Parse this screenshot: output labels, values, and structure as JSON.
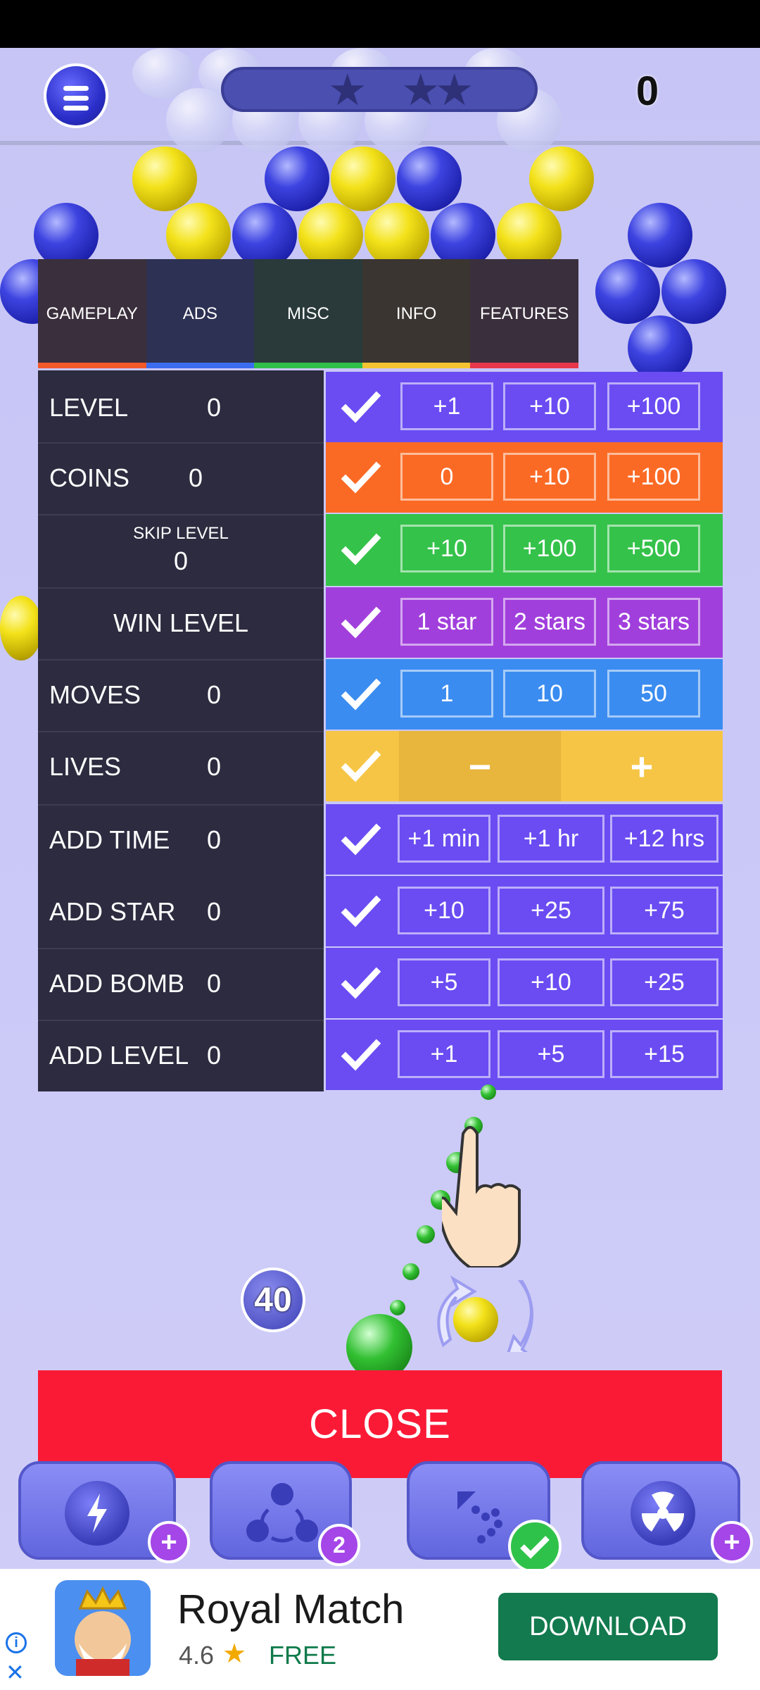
{
  "hud": {
    "score": "0",
    "stars": 3,
    "menu_icon": "hamburger-icon"
  },
  "tabs": [
    {
      "label": "GAMEPLAY",
      "color": "#f25a2a",
      "bg": "#3a2f3c"
    },
    {
      "label": "ADS",
      "color": "#3b6cf0",
      "bg": "#2d3153"
    },
    {
      "label": "MISC",
      "color": "#2fbf4a",
      "bg": "#2a3a3a"
    },
    {
      "label": "INFO",
      "color": "#f3c430",
      "bg": "#3a3530"
    },
    {
      "label": "FEATURES",
      "color": "#e8374b",
      "bg": "#3a2f3c"
    }
  ],
  "rows": [
    {
      "label": "LEVEL",
      "value": "0",
      "options": [
        "+1",
        "+10",
        "+100"
      ],
      "color": "#6a4cf2"
    },
    {
      "label": "COINS",
      "value": "0",
      "options": [
        "0",
        "+10",
        "+100"
      ],
      "color": "#fb6a25"
    },
    {
      "label": "SKIP LEVEL",
      "value": "0",
      "options": [
        "+10",
        "+100",
        "+500"
      ],
      "color": "#35c24a"
    },
    {
      "label": "WIN LEVEL",
      "value": "",
      "options": [
        "1 star",
        "2 stars",
        "3 stars"
      ],
      "color": "#a13fdc"
    },
    {
      "label": "MOVES",
      "value": "0",
      "options": [
        "1",
        "10",
        "50"
      ],
      "color": "#3b8cf0"
    },
    {
      "label": "LIVES",
      "value": "0",
      "options": [
        "−",
        "+"
      ],
      "color": "#f6c545"
    },
    {
      "label": "ADD TIME",
      "value": "0",
      "options": [
        "+1 min",
        "+1 hr",
        "+12 hrs"
      ],
      "color": "#6a4cf2"
    },
    {
      "label": "ADD STAR",
      "value": "0",
      "options": [
        "+10",
        "+25",
        "+75"
      ],
      "color": "#6a4cf2"
    },
    {
      "label": "ADD BOMB",
      "value": "0",
      "options": [
        "+5",
        "+10",
        "+25"
      ],
      "color": "#6a4cf2"
    },
    {
      "label": "ADD LEVEL",
      "value": "0",
      "options": [
        "+1",
        "+5",
        "+15"
      ],
      "color": "#6a4cf2"
    }
  ],
  "game": {
    "moves_left": "40"
  },
  "close_label": "CLOSE",
  "tools": [
    {
      "icon": "lightning-icon",
      "badge": "+"
    },
    {
      "icon": "swap-icon",
      "badge": "2"
    },
    {
      "icon": "aim-icon",
      "badge": "✔"
    },
    {
      "icon": "radiation-icon",
      "badge": "+"
    }
  ],
  "ad": {
    "title": "Royal Match",
    "rating": "4.6",
    "price": "FREE",
    "button": "DOWNLOAD"
  }
}
